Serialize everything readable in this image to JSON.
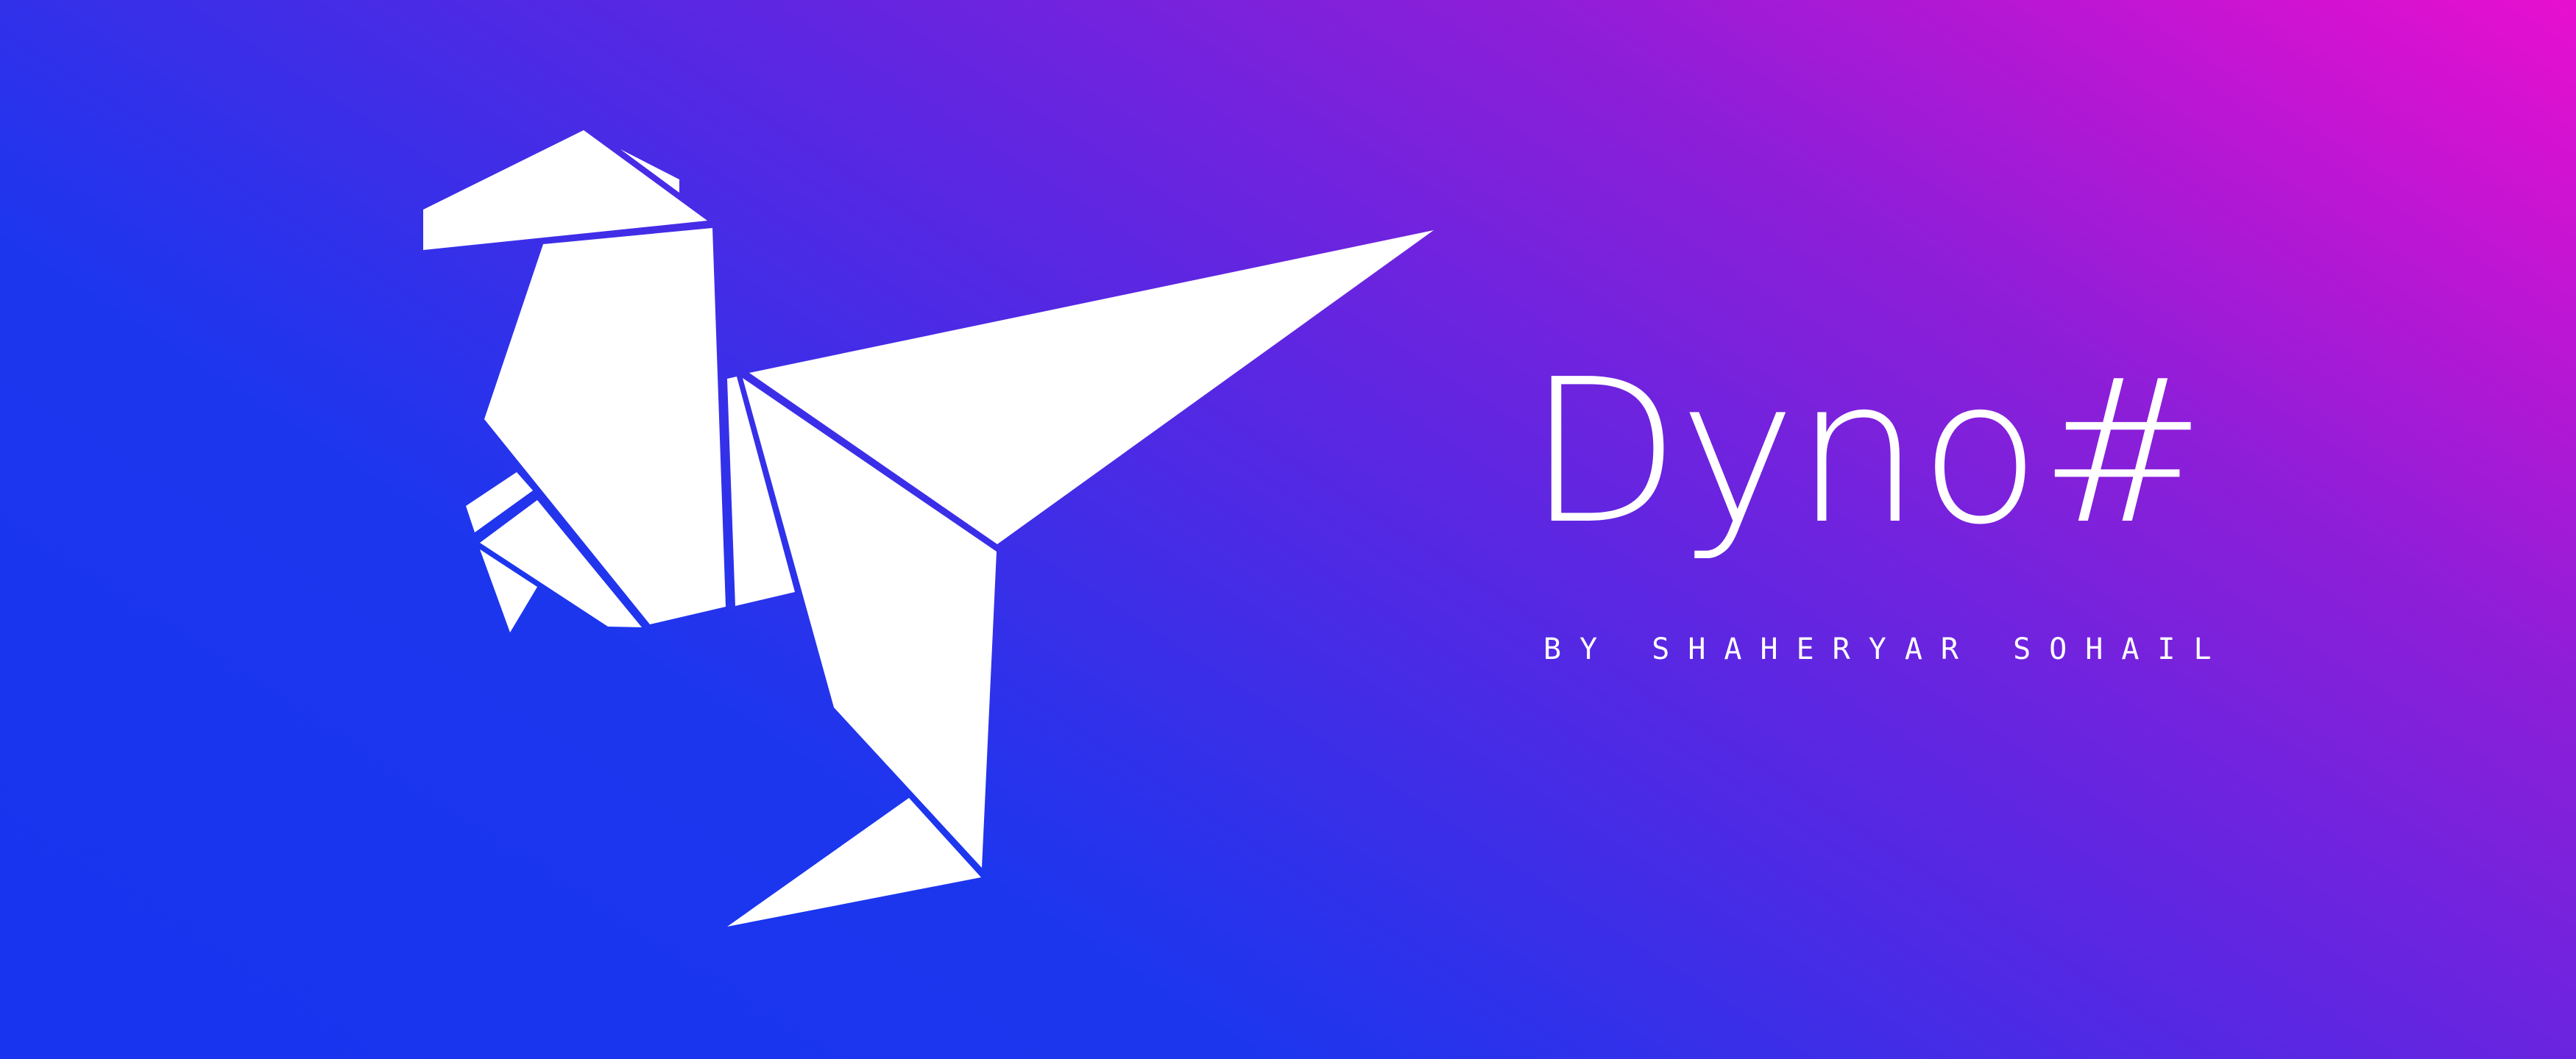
{
  "brand": {
    "name": "Dyno#",
    "byline": "BY SHAHERYAR SOHAIL"
  },
  "logo": {
    "icon": "origami-dinosaur-icon",
    "color": "#ffffff"
  },
  "colors": {
    "gradient_magenta": "#e80fcf",
    "gradient_purple": "#8e1ed8",
    "gradient_blue": "#1834ee",
    "text": "#ffffff"
  }
}
